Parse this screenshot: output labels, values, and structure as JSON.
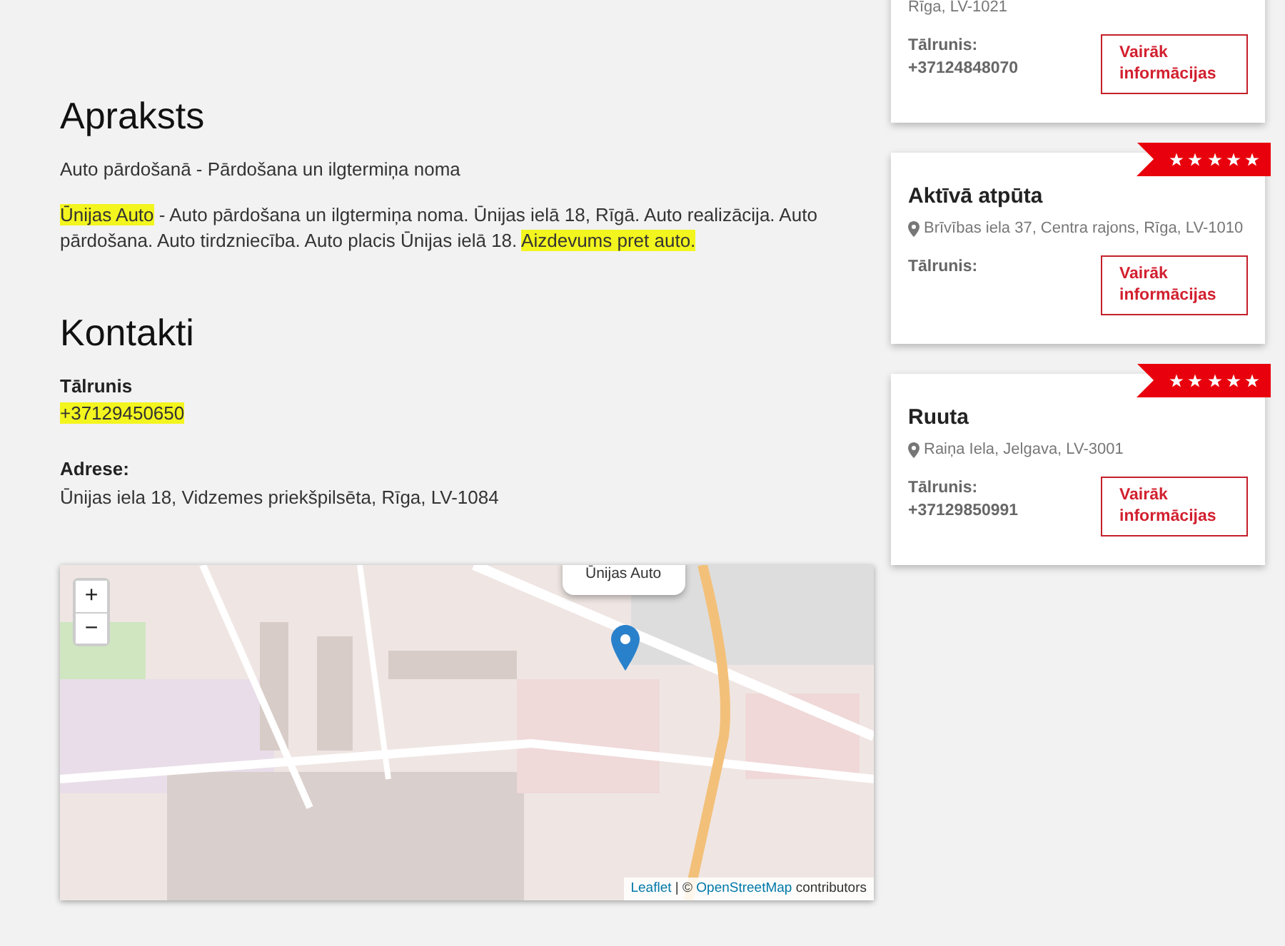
{
  "description": {
    "heading": "Apraksts",
    "subtitle": "Auto pārdošanā - Pārdošana un ilgtermiņa noma",
    "paragraph": [
      {
        "text": "Ūnijas Auto",
        "highlighted": true
      },
      {
        "text": " - Auto pārdošana un ilgtermiņa noma. Ūnijas ielā 18, Rīgā. Auto realizācija. Auto pārdošana. Auto tirdzniecība. Auto placis Ūnijas ielā 18. ",
        "highlighted": false
      },
      {
        "text": "Aizdevums pret auto.",
        "highlighted": true
      }
    ]
  },
  "contacts": {
    "heading": "Kontakti",
    "phone_label": "Tālrunis",
    "phone": {
      "text": "+37129450650",
      "highlighted": true
    },
    "address_label": "Adrese:",
    "address": "Ūnijas iela 18, Vidzemes priekšpilsēta, Rīga, LV-1084"
  },
  "map": {
    "popup": "Ūnijas Auto",
    "zoom_in": "+",
    "zoom_out": "−",
    "attribution": [
      {
        "kind": "link",
        "text": "Leaflet"
      },
      {
        "kind": "text",
        "text": " | © "
      },
      {
        "kind": "link",
        "text": "OpenStreetMap"
      },
      {
        "kind": "text",
        "text": " contributors"
      }
    ]
  },
  "listings": [
    {
      "address": "Rīga, LV-1021",
      "phone_label": "Tālrunis:",
      "phone": "+37124848070",
      "button": "Vairāk informācijas"
    },
    {
      "stars": 5,
      "name": "Aktīvā atpūta",
      "address": "Brīvības iela 37, Centra rajons, Rīga, LV-1010",
      "phone_label": "Tālrunis:",
      "button": "Vairāk informācijas"
    },
    {
      "stars": 5,
      "name": "Ruuta",
      "address": "Raiņa Iela, Jelgava, LV-3001",
      "phone_label": "Tālrunis:",
      "phone": "+37129850991",
      "button": "Vairāk informācijas"
    }
  ]
}
